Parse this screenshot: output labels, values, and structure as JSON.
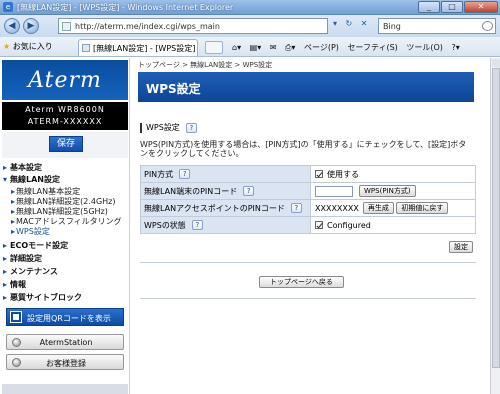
{
  "window": {
    "title": "[無線LAN設定] - [WPS設定] - Windows Internet Explorer",
    "url": "http://aterm.me/index.cgi/wps_main",
    "search_engine": "Bing",
    "favorites_label": "お気に入り",
    "tab_label": "[無線LAN設定] - [WPS設定]",
    "cmd": {
      "page": "ページ(P)",
      "safety": "セーフティ(S)",
      "tools": "ツール(O)"
    }
  },
  "sidebar": {
    "logo": "Aterm",
    "model": "Aterm WR8600N",
    "serial": "ATERM-XXXXXX",
    "save_label": "保存",
    "menu": [
      {
        "label": "基本設定"
      },
      {
        "label": "無線LAN設定"
      },
      {
        "label": "ECOモード設定"
      },
      {
        "label": "詳細設定"
      },
      {
        "label": "メンテナンス"
      },
      {
        "label": "情報"
      },
      {
        "label": "悪質サイトブロック"
      }
    ],
    "submenu": [
      {
        "label": "無線LAN基本設定"
      },
      {
        "label": "無線LAN詳細設定(2.4GHz)"
      },
      {
        "label": "無線LAN詳細設定(5GHz)"
      },
      {
        "label": "MACアドレスフィルタリング"
      },
      {
        "label": "WPS設定"
      }
    ],
    "qr_label": "設定用QRコードを表示",
    "atermstation_label": "AtermStation",
    "register_label": "お客様登録"
  },
  "main": {
    "breadcrumb": "トップページ > 無線LAN設定 > WPS設定",
    "title": "WPS設定",
    "section_title": "WPS設定",
    "help_label": "?",
    "description": "WPS(PIN方式)を使用する場合は、[PIN方式]の「使用する」にチェックをして、[設定]ボタンをクリックしてください。",
    "rows": [
      {
        "label": "PIN方式",
        "value": "使用する"
      },
      {
        "label": "無線LAN端末のPINコード",
        "button": "WPS(PIN方式)"
      },
      {
        "label": "無線LANアクセスポイントのPINコード",
        "value": "XXXXXXXX",
        "btn1": "再生成",
        "btn2": "初期値に戻す"
      },
      {
        "label": "WPSの状態",
        "value": "Configured"
      }
    ],
    "set_label": "設定",
    "top_label": "トップページへ戻る"
  }
}
